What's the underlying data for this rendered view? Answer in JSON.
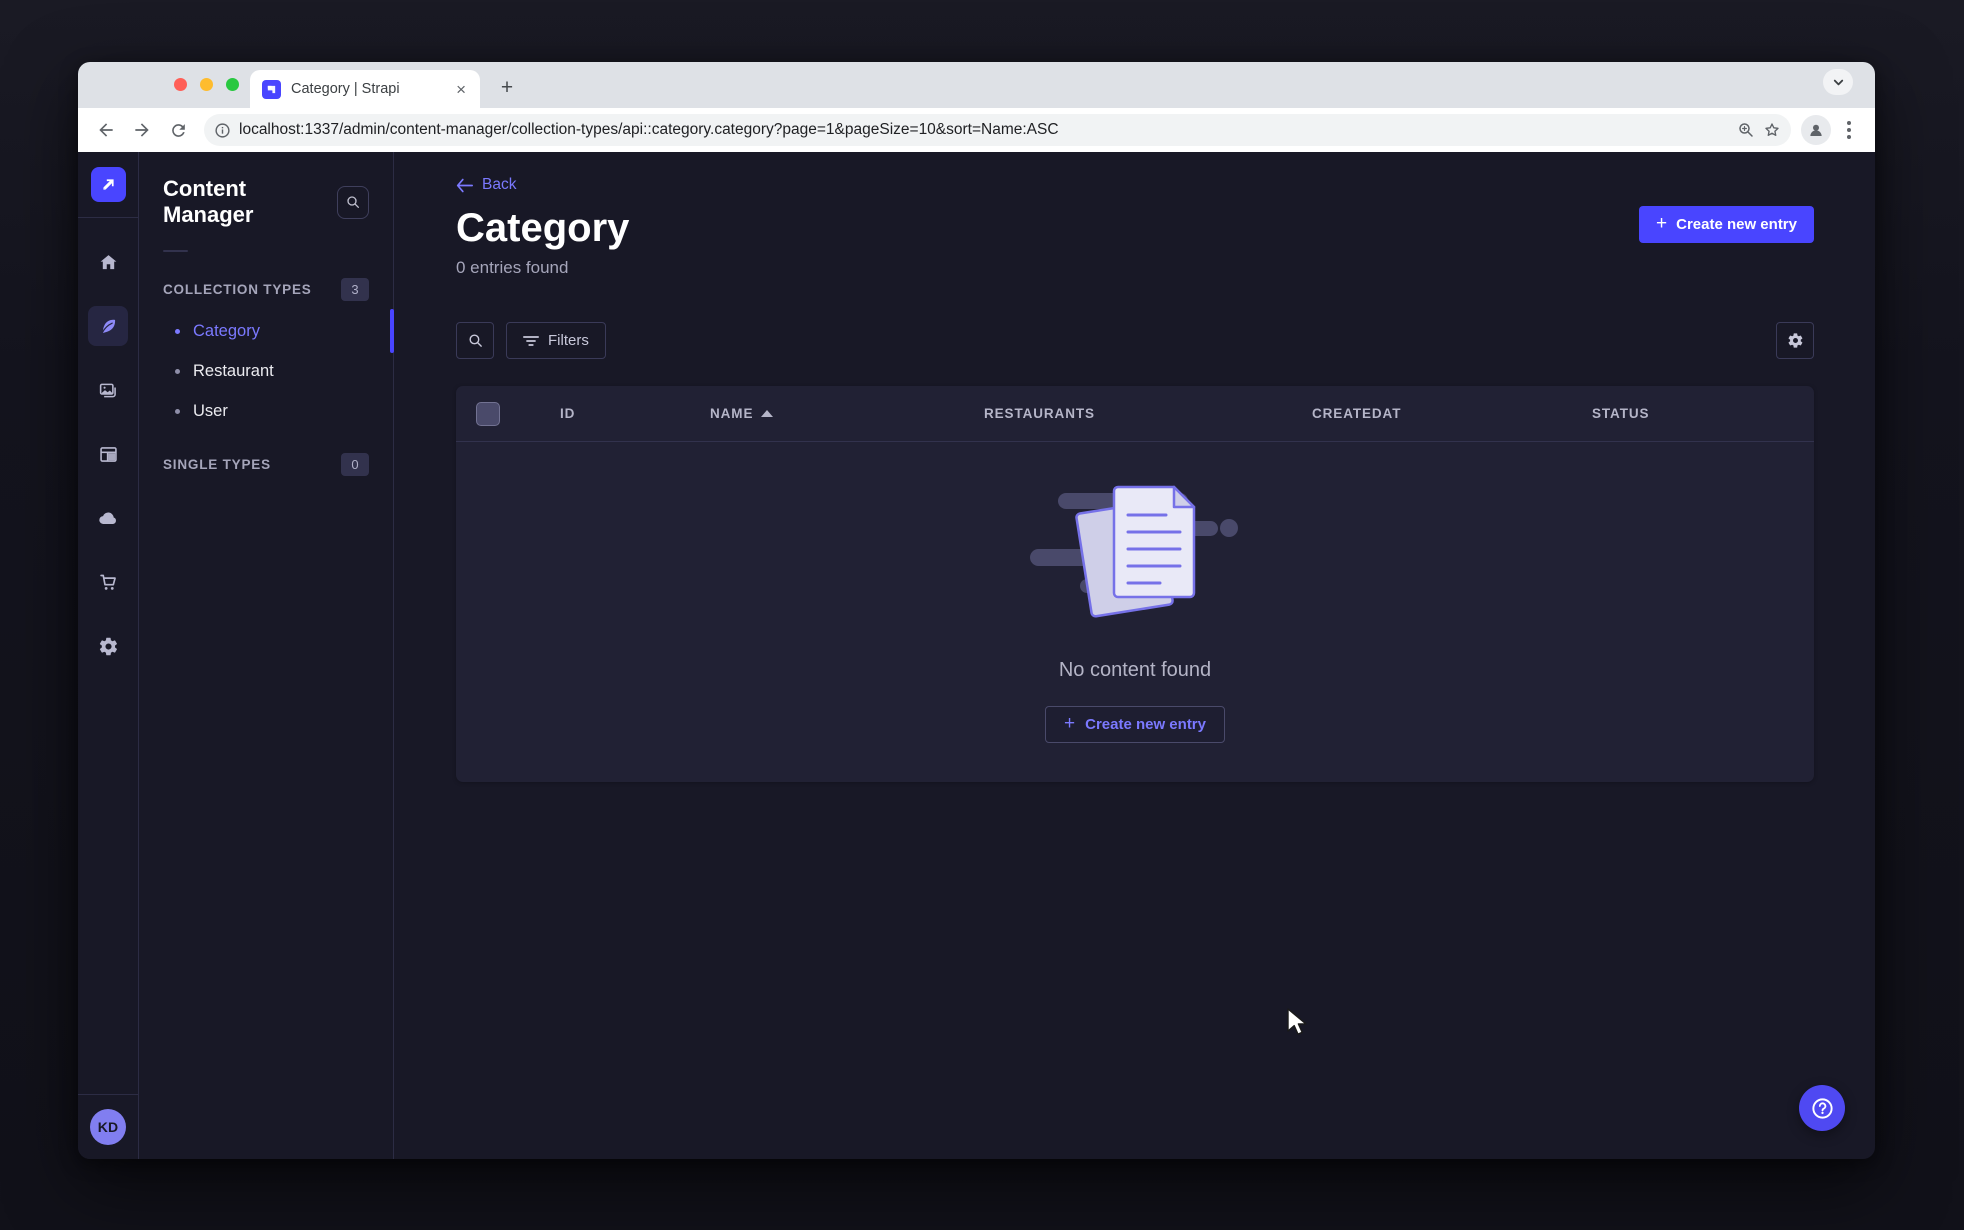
{
  "browser": {
    "tab_title": "Category | Strapi",
    "url": "localhost:1337/admin/content-manager/collection-types/api::category.category?page=1&pageSize=10&sort=Name:ASC",
    "new_tab_glyph": "+",
    "close_tab_glyph": "×"
  },
  "rail": {
    "avatar_initials": "KD",
    "items": [
      {
        "name": "home"
      },
      {
        "name": "content-manager",
        "active": true
      },
      {
        "name": "media-library"
      },
      {
        "name": "content-type-builder"
      },
      {
        "name": "cloud"
      },
      {
        "name": "marketplace"
      },
      {
        "name": "settings"
      }
    ]
  },
  "panel": {
    "title": "Content Manager",
    "collection": {
      "label": "COLLECTION TYPES",
      "badge": "3",
      "items": [
        {
          "label": "Category",
          "active": true
        },
        {
          "label": "Restaurant",
          "active": false
        },
        {
          "label": "User",
          "active": false
        }
      ]
    },
    "single": {
      "label": "SINGLE TYPES",
      "badge": "0"
    }
  },
  "main": {
    "back_label": "Back",
    "title": "Category",
    "subtitle": "0 entries found",
    "create_label": "Create new entry",
    "filters_label": "Filters",
    "table": {
      "columns": [
        "ID",
        "NAME",
        "RESTAURANTS",
        "CREATEDAT",
        "STATUS"
      ],
      "sorted_column": "NAME",
      "sort_direction": "ASC",
      "rows": [],
      "empty_message": "No content found",
      "empty_cta_label": "Create new entry"
    }
  },
  "icons": {
    "browser": [
      "back-arrow",
      "forward-arrow",
      "reload",
      "info-circle",
      "zoom",
      "star",
      "profile",
      "kebab-menu",
      "chevron-down"
    ],
    "app": [
      "strapi-logo",
      "search",
      "filter-lines",
      "plus",
      "gear",
      "sort-ascending-triangle",
      "question-mark",
      "empty-documents-illustration"
    ]
  },
  "colors": {
    "primary": "#4945ff",
    "primary_light": "#7b79ff",
    "surface": "#212134",
    "background": "#181826",
    "border": "#32324d"
  }
}
